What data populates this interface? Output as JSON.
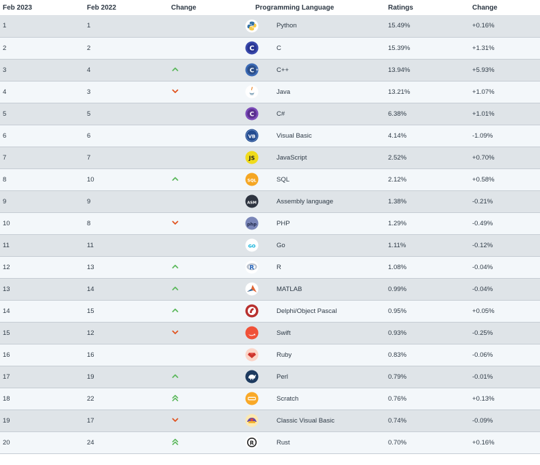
{
  "headers": {
    "feb2023": "Feb 2023",
    "feb2022": "Feb 2022",
    "change": "Change",
    "language": "Programming Language",
    "ratings": "Ratings",
    "change2": "Change"
  },
  "rows": [
    {
      "rank2023": "1",
      "rank2022": "1",
      "trend": "none",
      "icon": "python-icon",
      "language": "Python",
      "rating": "15.49%",
      "change": "+0.16%"
    },
    {
      "rank2023": "2",
      "rank2022": "2",
      "trend": "none",
      "icon": "c-icon",
      "language": "C",
      "rating": "15.39%",
      "change": "+1.31%"
    },
    {
      "rank2023": "3",
      "rank2022": "4",
      "trend": "up",
      "icon": "cpp-icon",
      "language": "C++",
      "rating": "13.94%",
      "change": "+5.93%"
    },
    {
      "rank2023": "4",
      "rank2022": "3",
      "trend": "down",
      "icon": "java-icon",
      "language": "Java",
      "rating": "13.21%",
      "change": "+1.07%"
    },
    {
      "rank2023": "5",
      "rank2022": "5",
      "trend": "none",
      "icon": "csharp-icon",
      "language": "C#",
      "rating": "6.38%",
      "change": "+1.01%"
    },
    {
      "rank2023": "6",
      "rank2022": "6",
      "trend": "none",
      "icon": "visual-basic-icon",
      "language": "Visual Basic",
      "rating": "4.14%",
      "change": "-1.09%"
    },
    {
      "rank2023": "7",
      "rank2022": "7",
      "trend": "none",
      "icon": "javascript-icon",
      "language": "JavaScript",
      "rating": "2.52%",
      "change": "+0.70%"
    },
    {
      "rank2023": "8",
      "rank2022": "10",
      "trend": "up",
      "icon": "sql-icon",
      "language": "SQL",
      "rating": "2.12%",
      "change": "+0.58%"
    },
    {
      "rank2023": "9",
      "rank2022": "9",
      "trend": "none",
      "icon": "assembly-icon",
      "language": "Assembly language",
      "rating": "1.38%",
      "change": "-0.21%"
    },
    {
      "rank2023": "10",
      "rank2022": "8",
      "trend": "down",
      "icon": "php-icon",
      "language": "PHP",
      "rating": "1.29%",
      "change": "-0.49%"
    },
    {
      "rank2023": "11",
      "rank2022": "11",
      "trend": "none",
      "icon": "go-icon",
      "language": "Go",
      "rating": "1.11%",
      "change": "-0.12%"
    },
    {
      "rank2023": "12",
      "rank2022": "13",
      "trend": "up",
      "icon": "r-icon",
      "language": "R",
      "rating": "1.08%",
      "change": "-0.04%"
    },
    {
      "rank2023": "13",
      "rank2022": "14",
      "trend": "up",
      "icon": "matlab-icon",
      "language": "MATLAB",
      "rating": "0.99%",
      "change": "-0.04%"
    },
    {
      "rank2023": "14",
      "rank2022": "15",
      "trend": "up",
      "icon": "delphi-icon",
      "language": "Delphi/Object Pascal",
      "rating": "0.95%",
      "change": "+0.05%"
    },
    {
      "rank2023": "15",
      "rank2022": "12",
      "trend": "down",
      "icon": "swift-icon",
      "language": "Swift",
      "rating": "0.93%",
      "change": "-0.25%"
    },
    {
      "rank2023": "16",
      "rank2022": "16",
      "trend": "none",
      "icon": "ruby-icon",
      "language": "Ruby",
      "rating": "0.83%",
      "change": "-0.06%"
    },
    {
      "rank2023": "17",
      "rank2022": "19",
      "trend": "up",
      "icon": "perl-icon",
      "language": "Perl",
      "rating": "0.79%",
      "change": "-0.01%"
    },
    {
      "rank2023": "18",
      "rank2022": "22",
      "trend": "double-up",
      "icon": "scratch-icon",
      "language": "Scratch",
      "rating": "0.76%",
      "change": "+0.13%"
    },
    {
      "rank2023": "19",
      "rank2022": "17",
      "trend": "down",
      "icon": "classic-visual-basic-icon",
      "language": "Classic Visual Basic",
      "rating": "0.74%",
      "change": "-0.09%"
    },
    {
      "rank2023": "20",
      "rank2022": "24",
      "trend": "double-up",
      "icon": "rust-icon",
      "language": "Rust",
      "rating": "0.70%",
      "change": "+0.16%"
    }
  ],
  "icon_labels": {
    "visual-basic-icon": "VB",
    "javascript-icon": "JS",
    "sql-icon": "SQL",
    "assembly-icon": "ASM",
    "php-icon": "php",
    "go-icon": "GO",
    "r-icon": "R",
    "rust-icon": "R"
  },
  "colors": {
    "up": "#5cb85c",
    "down": "#e0531f",
    "row_odd": "#dfe4e8",
    "row_even": "#f3f7fa"
  }
}
